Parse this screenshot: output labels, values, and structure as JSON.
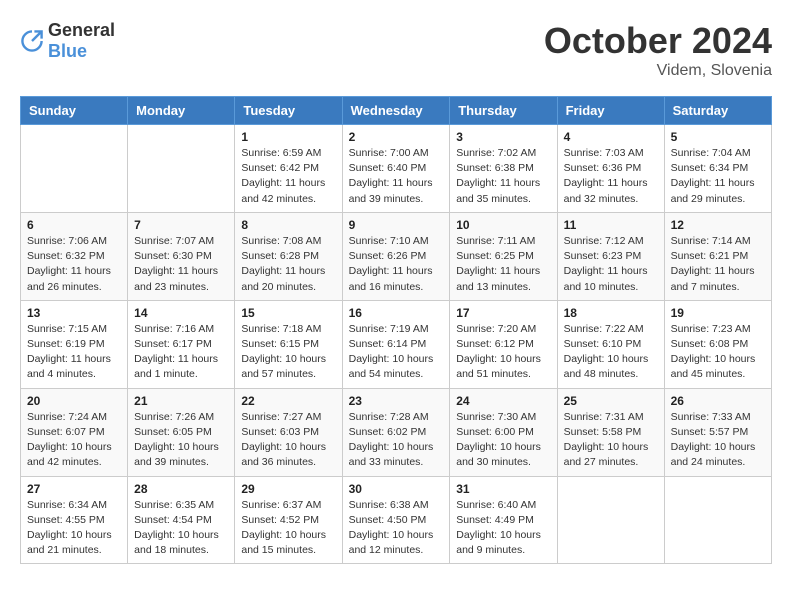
{
  "header": {
    "logo_general": "General",
    "logo_blue": "Blue",
    "month_title": "October 2024",
    "location": "Videm, Slovenia"
  },
  "weekdays": [
    "Sunday",
    "Monday",
    "Tuesday",
    "Wednesday",
    "Thursday",
    "Friday",
    "Saturday"
  ],
  "weeks": [
    [
      {
        "day": "",
        "info": ""
      },
      {
        "day": "",
        "info": ""
      },
      {
        "day": "1",
        "info": "Sunrise: 6:59 AM\nSunset: 6:42 PM\nDaylight: 11 hours and 42 minutes."
      },
      {
        "day": "2",
        "info": "Sunrise: 7:00 AM\nSunset: 6:40 PM\nDaylight: 11 hours and 39 minutes."
      },
      {
        "day": "3",
        "info": "Sunrise: 7:02 AM\nSunset: 6:38 PM\nDaylight: 11 hours and 35 minutes."
      },
      {
        "day": "4",
        "info": "Sunrise: 7:03 AM\nSunset: 6:36 PM\nDaylight: 11 hours and 32 minutes."
      },
      {
        "day": "5",
        "info": "Sunrise: 7:04 AM\nSunset: 6:34 PM\nDaylight: 11 hours and 29 minutes."
      }
    ],
    [
      {
        "day": "6",
        "info": "Sunrise: 7:06 AM\nSunset: 6:32 PM\nDaylight: 11 hours and 26 minutes."
      },
      {
        "day": "7",
        "info": "Sunrise: 7:07 AM\nSunset: 6:30 PM\nDaylight: 11 hours and 23 minutes."
      },
      {
        "day": "8",
        "info": "Sunrise: 7:08 AM\nSunset: 6:28 PM\nDaylight: 11 hours and 20 minutes."
      },
      {
        "day": "9",
        "info": "Sunrise: 7:10 AM\nSunset: 6:26 PM\nDaylight: 11 hours and 16 minutes."
      },
      {
        "day": "10",
        "info": "Sunrise: 7:11 AM\nSunset: 6:25 PM\nDaylight: 11 hours and 13 minutes."
      },
      {
        "day": "11",
        "info": "Sunrise: 7:12 AM\nSunset: 6:23 PM\nDaylight: 11 hours and 10 minutes."
      },
      {
        "day": "12",
        "info": "Sunrise: 7:14 AM\nSunset: 6:21 PM\nDaylight: 11 hours and 7 minutes."
      }
    ],
    [
      {
        "day": "13",
        "info": "Sunrise: 7:15 AM\nSunset: 6:19 PM\nDaylight: 11 hours and 4 minutes."
      },
      {
        "day": "14",
        "info": "Sunrise: 7:16 AM\nSunset: 6:17 PM\nDaylight: 11 hours and 1 minute."
      },
      {
        "day": "15",
        "info": "Sunrise: 7:18 AM\nSunset: 6:15 PM\nDaylight: 10 hours and 57 minutes."
      },
      {
        "day": "16",
        "info": "Sunrise: 7:19 AM\nSunset: 6:14 PM\nDaylight: 10 hours and 54 minutes."
      },
      {
        "day": "17",
        "info": "Sunrise: 7:20 AM\nSunset: 6:12 PM\nDaylight: 10 hours and 51 minutes."
      },
      {
        "day": "18",
        "info": "Sunrise: 7:22 AM\nSunset: 6:10 PM\nDaylight: 10 hours and 48 minutes."
      },
      {
        "day": "19",
        "info": "Sunrise: 7:23 AM\nSunset: 6:08 PM\nDaylight: 10 hours and 45 minutes."
      }
    ],
    [
      {
        "day": "20",
        "info": "Sunrise: 7:24 AM\nSunset: 6:07 PM\nDaylight: 10 hours and 42 minutes."
      },
      {
        "day": "21",
        "info": "Sunrise: 7:26 AM\nSunset: 6:05 PM\nDaylight: 10 hours and 39 minutes."
      },
      {
        "day": "22",
        "info": "Sunrise: 7:27 AM\nSunset: 6:03 PM\nDaylight: 10 hours and 36 minutes."
      },
      {
        "day": "23",
        "info": "Sunrise: 7:28 AM\nSunset: 6:02 PM\nDaylight: 10 hours and 33 minutes."
      },
      {
        "day": "24",
        "info": "Sunrise: 7:30 AM\nSunset: 6:00 PM\nDaylight: 10 hours and 30 minutes."
      },
      {
        "day": "25",
        "info": "Sunrise: 7:31 AM\nSunset: 5:58 PM\nDaylight: 10 hours and 27 minutes."
      },
      {
        "day": "26",
        "info": "Sunrise: 7:33 AM\nSunset: 5:57 PM\nDaylight: 10 hours and 24 minutes."
      }
    ],
    [
      {
        "day": "27",
        "info": "Sunrise: 6:34 AM\nSunset: 4:55 PM\nDaylight: 10 hours and 21 minutes."
      },
      {
        "day": "28",
        "info": "Sunrise: 6:35 AM\nSunset: 4:54 PM\nDaylight: 10 hours and 18 minutes."
      },
      {
        "day": "29",
        "info": "Sunrise: 6:37 AM\nSunset: 4:52 PM\nDaylight: 10 hours and 15 minutes."
      },
      {
        "day": "30",
        "info": "Sunrise: 6:38 AM\nSunset: 4:50 PM\nDaylight: 10 hours and 12 minutes."
      },
      {
        "day": "31",
        "info": "Sunrise: 6:40 AM\nSunset: 4:49 PM\nDaylight: 10 hours and 9 minutes."
      },
      {
        "day": "",
        "info": ""
      },
      {
        "day": "",
        "info": ""
      }
    ]
  ]
}
